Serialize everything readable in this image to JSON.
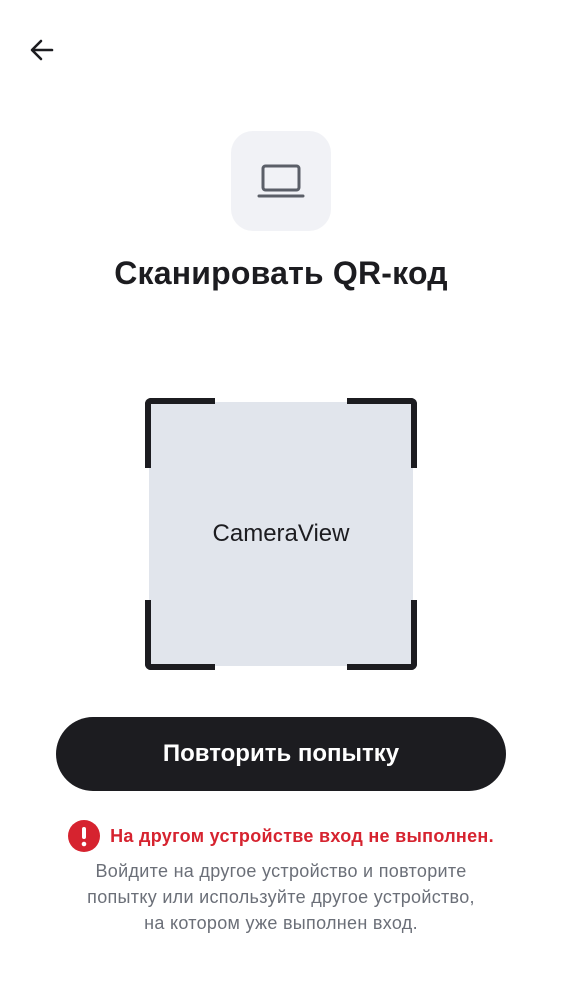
{
  "header": {
    "back_icon": "arrow-left-icon"
  },
  "hero": {
    "device_icon": "laptop-icon",
    "title": "Сканировать QR-код"
  },
  "scanner": {
    "camera_label": "CameraView"
  },
  "actions": {
    "retry_label": "Повторить попытку"
  },
  "error": {
    "icon": "exclamation-circle-icon",
    "message": "На другом устройстве вход не выполнен.",
    "help_lines": [
      "Войдите на другое устройство и повторите",
      "попытку или используйте другое устройство,",
      "на котором уже выполнен вход."
    ]
  },
  "colors": {
    "primary": "#1c1c20",
    "error": "#d6232f",
    "camera_bg": "#e1e5ec",
    "tile_bg": "#f1f2f6",
    "muted_text": "#6b6f78"
  }
}
